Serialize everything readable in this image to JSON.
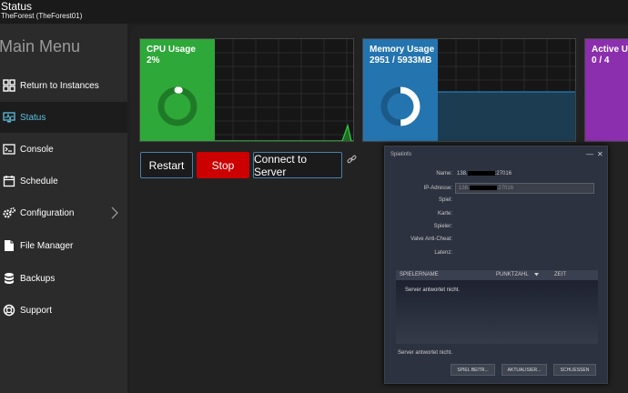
{
  "header": {
    "title": "Status",
    "subtitle": "TheForest (TheForest01)"
  },
  "sidebar": {
    "menu_title": "Main Menu",
    "items": [
      {
        "label": "Return to Instances",
        "icon": "grid-icon"
      },
      {
        "label": "Status",
        "icon": "monitor-icon",
        "active": true
      },
      {
        "label": "Console",
        "icon": "terminal-icon"
      },
      {
        "label": "Schedule",
        "icon": "calendar-icon"
      },
      {
        "label": "Configuration",
        "icon": "gears-icon"
      },
      {
        "label": "File Manager",
        "icon": "file-icon"
      },
      {
        "label": "Backups",
        "icon": "database-icon"
      },
      {
        "label": "Support",
        "icon": "lifebuoy-icon"
      }
    ]
  },
  "cards": [
    {
      "title": "CPU Usage",
      "value": "2%",
      "color": "#2fa83a",
      "fraction": 0.02
    },
    {
      "title": "Memory Usage",
      "value": "2951 / 5933MB",
      "color": "#2474b0",
      "fraction": 0.497
    },
    {
      "title": "Active Users",
      "value": "0 / 4",
      "color": "#8b2fae",
      "fraction": 0
    }
  ],
  "buttons": {
    "restart": "Restart",
    "stop": "Stop",
    "connect": "Connect to Server"
  },
  "dialog": {
    "title": "Spielinfo",
    "name_label": "Name:",
    "name_prefix": "138.",
    "name_suffix": ":27016",
    "ip_label": "IP-Adresse:",
    "ip_prefix": "138.",
    "ip_suffix": ":27016",
    "game_label": "Spiel:",
    "map_label": "Karte:",
    "players_label": "Spieler:",
    "vac_label": "Valve Anti-Cheat:",
    "latency_label": "Latenz:",
    "col_player": "SPIELERNAME",
    "col_score": "PUNKTZAHL",
    "col_time": "ZEIT",
    "no_response_list": "Server antwortet nicht.",
    "no_response_status": "Server antwortet nicht.",
    "btn_join": "SPIEL BEITR...",
    "btn_refresh": "AKTUALISIER...",
    "btn_close": "SCHLIESSEN"
  }
}
